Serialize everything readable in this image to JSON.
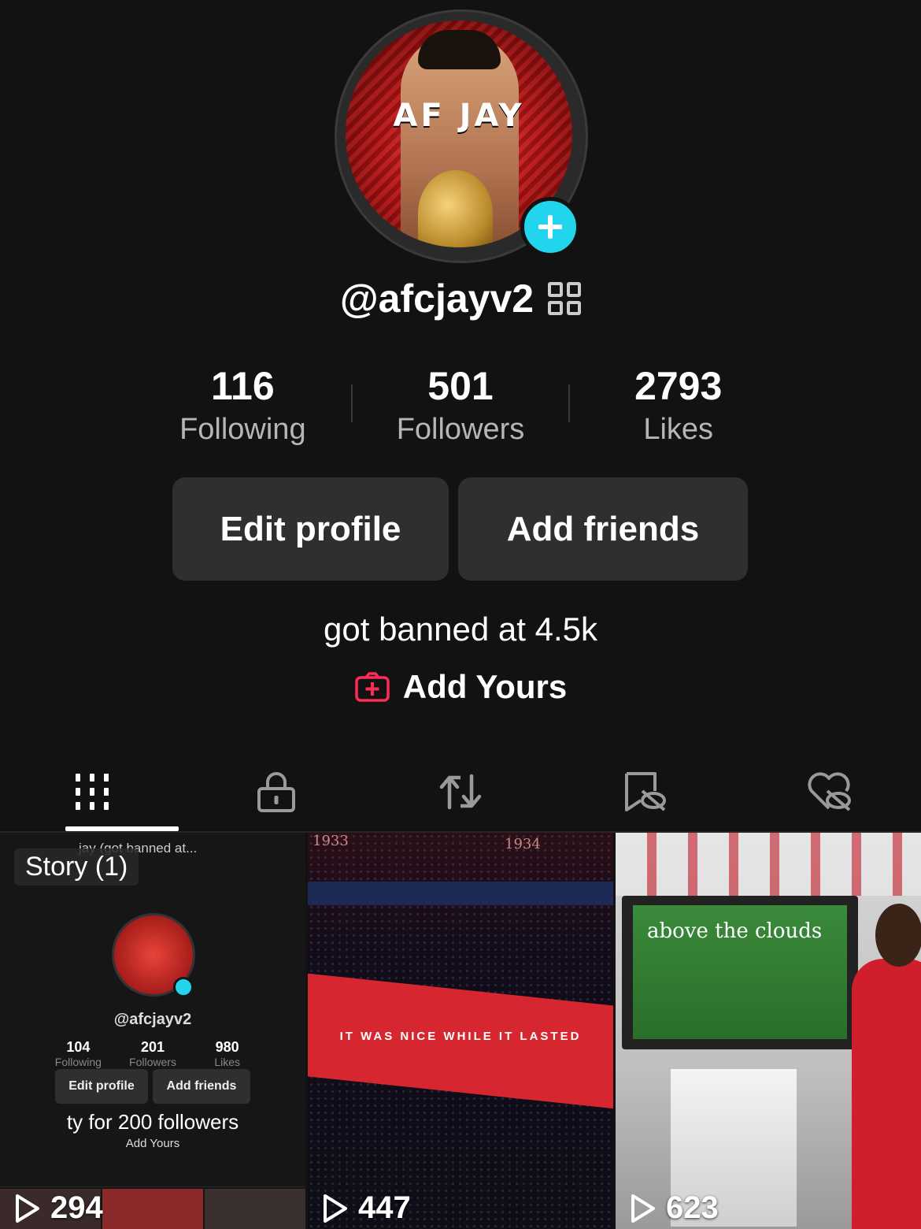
{
  "profile": {
    "username": "@afcjayv2",
    "avatar_text": "AF JAY",
    "bio": "got banned at 4.5k",
    "add_yours_label": "Add Yours"
  },
  "stats": [
    {
      "value": "116",
      "label": "Following"
    },
    {
      "value": "501",
      "label": "Followers"
    },
    {
      "value": "2793",
      "label": "Likes"
    }
  ],
  "buttons": {
    "edit_profile": "Edit profile",
    "add_friends": "Add friends"
  },
  "tabs": [
    {
      "icon": "grid-icon",
      "active": true
    },
    {
      "icon": "lock-icon",
      "active": false
    },
    {
      "icon": "repost-icon",
      "active": false
    },
    {
      "icon": "bookmark-icon",
      "active": false
    },
    {
      "icon": "liked-icon",
      "active": false
    }
  ],
  "videos": [
    {
      "views": "294",
      "story_label": "Story (1)",
      "mini": {
        "top_text": "jay (got banned at...",
        "username": "@afcjayv2",
        "stats": [
          {
            "value": "104",
            "label": "Following"
          },
          {
            "value": "201",
            "label": "Followers"
          },
          {
            "value": "980",
            "label": "Likes"
          }
        ],
        "edit_profile": "Edit profile",
        "add_friends": "Add friends",
        "bio": "ty for 200 followers",
        "add_yours": "Add Yours"
      }
    },
    {
      "views": "447",
      "overlay_text": "IT WAS NICE WHILE IT LASTED",
      "year_left": "1933",
      "year_right": "1934"
    },
    {
      "views": "623",
      "tv_text": "above the clouds"
    }
  ],
  "colors": {
    "background": "#121212",
    "accent": "#20d5ec",
    "add_yours": "#fe2c55",
    "button_bg": "#2f2f2f"
  }
}
